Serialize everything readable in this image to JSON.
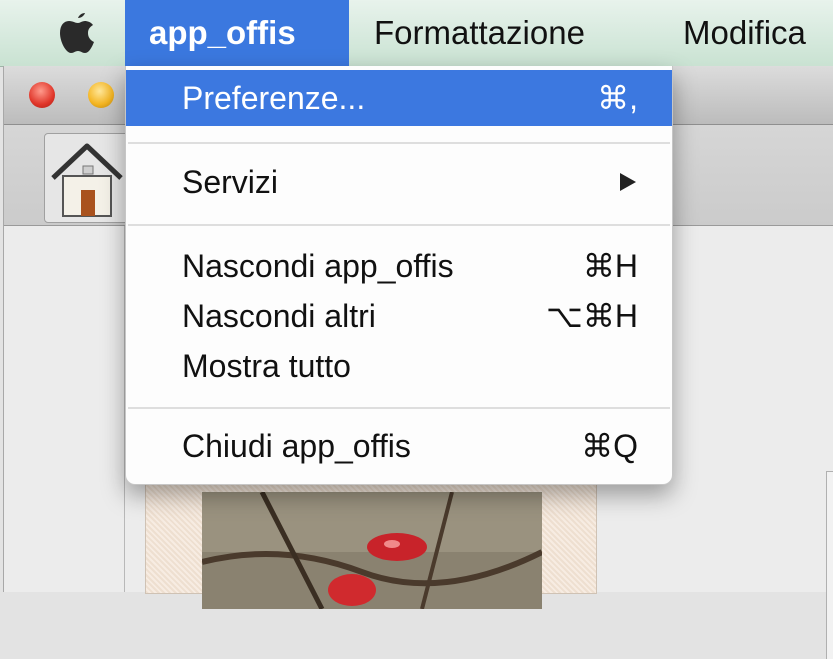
{
  "menubar": {
    "active_menu": "app_offis",
    "menu2": "Formattazione",
    "menu3": "Modifica"
  },
  "icons": {
    "apple": "apple-logo-icon",
    "home": "home-icon",
    "submenu": "submenu-arrow-icon"
  },
  "colors": {
    "highlight": "#3c78e0",
    "menubar": "#d4eadb"
  },
  "dropdown": {
    "items": [
      {
        "label": "Preferenze...",
        "shortcut": "⌘,",
        "highlighted": true
      },
      {
        "label": "Servizi",
        "submenu": true
      },
      {
        "label": "Nascondi app_offis",
        "shortcut": "⌘H"
      },
      {
        "label": "Nascondi altri",
        "shortcut": "⌥⌘H"
      },
      {
        "label": "Mostra tutto",
        "shortcut": ""
      },
      {
        "label": "Chiudi app_offis",
        "shortcut": "⌘Q"
      }
    ]
  }
}
